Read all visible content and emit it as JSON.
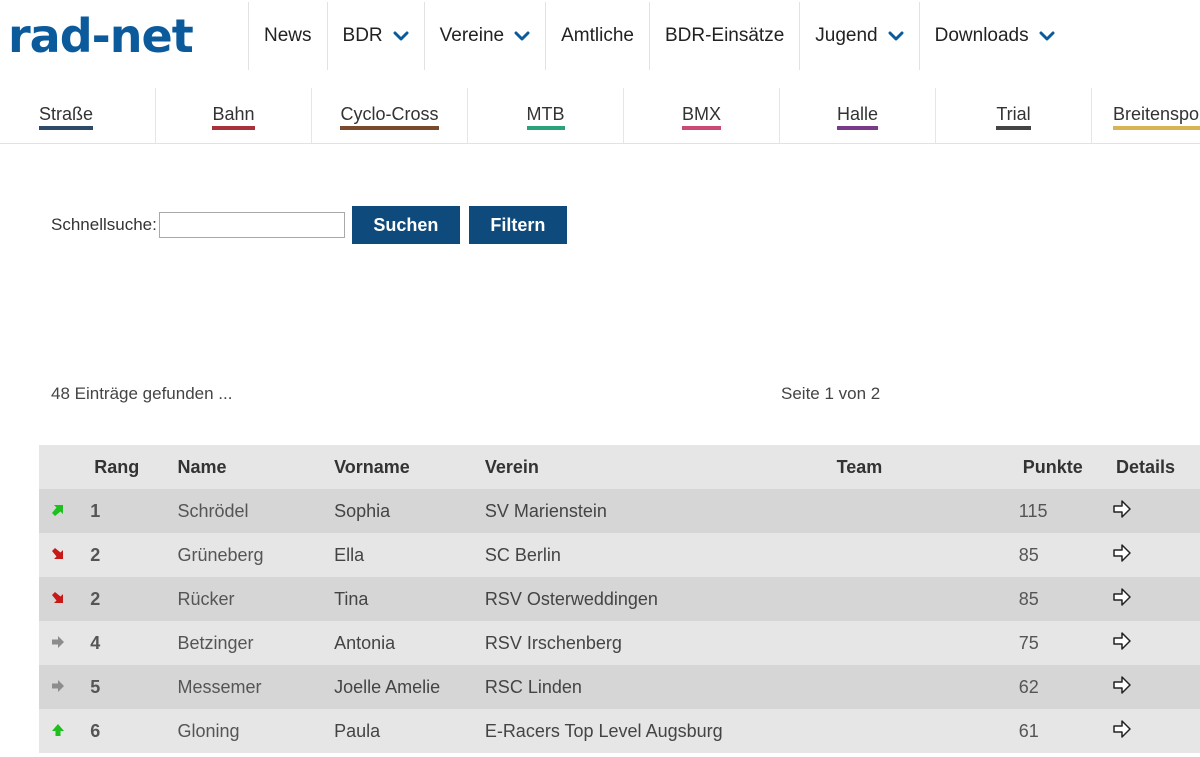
{
  "brand": {
    "logo_text": "rad-net",
    "color": "#0a5a9c"
  },
  "nav": [
    {
      "label": "News",
      "dropdown": false
    },
    {
      "label": "BDR",
      "dropdown": true
    },
    {
      "label": "Vereine",
      "dropdown": true
    },
    {
      "label": "Amtliche",
      "dropdown": false
    },
    {
      "label": "BDR-Einsätze",
      "dropdown": false
    },
    {
      "label": "Jugend",
      "dropdown": true
    },
    {
      "label": "Downloads",
      "dropdown": true
    }
  ],
  "disciplines": [
    {
      "label": "Straße",
      "color": "#2e4a6b"
    },
    {
      "label": "Bahn",
      "color": "#a8323a"
    },
    {
      "label": "Cyclo-Cross",
      "color": "#7a4a2e"
    },
    {
      "label": "MTB",
      "color": "#2aa37d"
    },
    {
      "label": "BMX",
      "color": "#c94a72"
    },
    {
      "label": "Halle",
      "color": "#7a3a8c"
    },
    {
      "label": "Trial",
      "color": "#444444"
    },
    {
      "label": "Breitensport",
      "color": "#d9b455"
    }
  ],
  "search": {
    "label": "Schnellsuche:",
    "value": "",
    "search_button": "Suchen",
    "filter_button": "Filtern"
  },
  "results": {
    "found_text": "48 Einträge gefunden ...",
    "page_text": "Seite 1 von 2"
  },
  "table": {
    "headers": {
      "rang": "Rang",
      "name": "Name",
      "vorname": "Vorname",
      "verein": "Verein",
      "team": "Team",
      "punkte": "Punkte",
      "details": "Details"
    },
    "rows": [
      {
        "trend": "up-right",
        "rang": "1",
        "name": "Schrödel",
        "vorname": "Sophia",
        "verein": "SV Marienstein",
        "team": "",
        "punkte": "115"
      },
      {
        "trend": "down-right",
        "rang": "2",
        "name": "Grüneberg",
        "vorname": "Ella",
        "verein": "SC Berlin",
        "team": "",
        "punkte": "85"
      },
      {
        "trend": "down-right",
        "rang": "2",
        "name": "Rücker",
        "vorname": "Tina",
        "verein": "RSV Osterweddingen",
        "team": "",
        "punkte": "85"
      },
      {
        "trend": "right",
        "rang": "4",
        "name": "Betzinger",
        "vorname": "Antonia",
        "verein": "RSV Irschenberg",
        "team": "",
        "punkte": "75"
      },
      {
        "trend": "right",
        "rang": "5",
        "name": "Messemer",
        "vorname": "Joelle Amelie",
        "verein": "RSC Linden",
        "team": "",
        "punkte": "62"
      },
      {
        "trend": "up",
        "rang": "6",
        "name": "Gloning",
        "vorname": "Paula",
        "verein": "E-Racers Top Level Augsburg",
        "team": "",
        "punkte": "61"
      }
    ]
  }
}
